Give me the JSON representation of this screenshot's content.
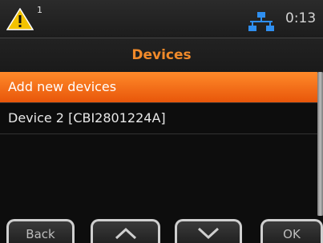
{
  "status": {
    "warning_icon": "warning-icon",
    "warning_count": "1",
    "network_icon": "network-icon",
    "time": "0:13"
  },
  "header": {
    "title": "Devices"
  },
  "list": {
    "items": [
      {
        "label": "Add new devices",
        "selected": true
      },
      {
        "label": "Device 2 [CBI2801224A]",
        "selected": false
      }
    ]
  },
  "softkeys": {
    "back_label": "Back",
    "up_icon": "chevron-up-icon",
    "down_icon": "chevron-down-icon",
    "ok_label": "OK"
  },
  "colors": {
    "accent": "#f18a2a",
    "selection": "#ff7a1a",
    "network": "#2f8ff0",
    "warning": "#f2c200"
  }
}
